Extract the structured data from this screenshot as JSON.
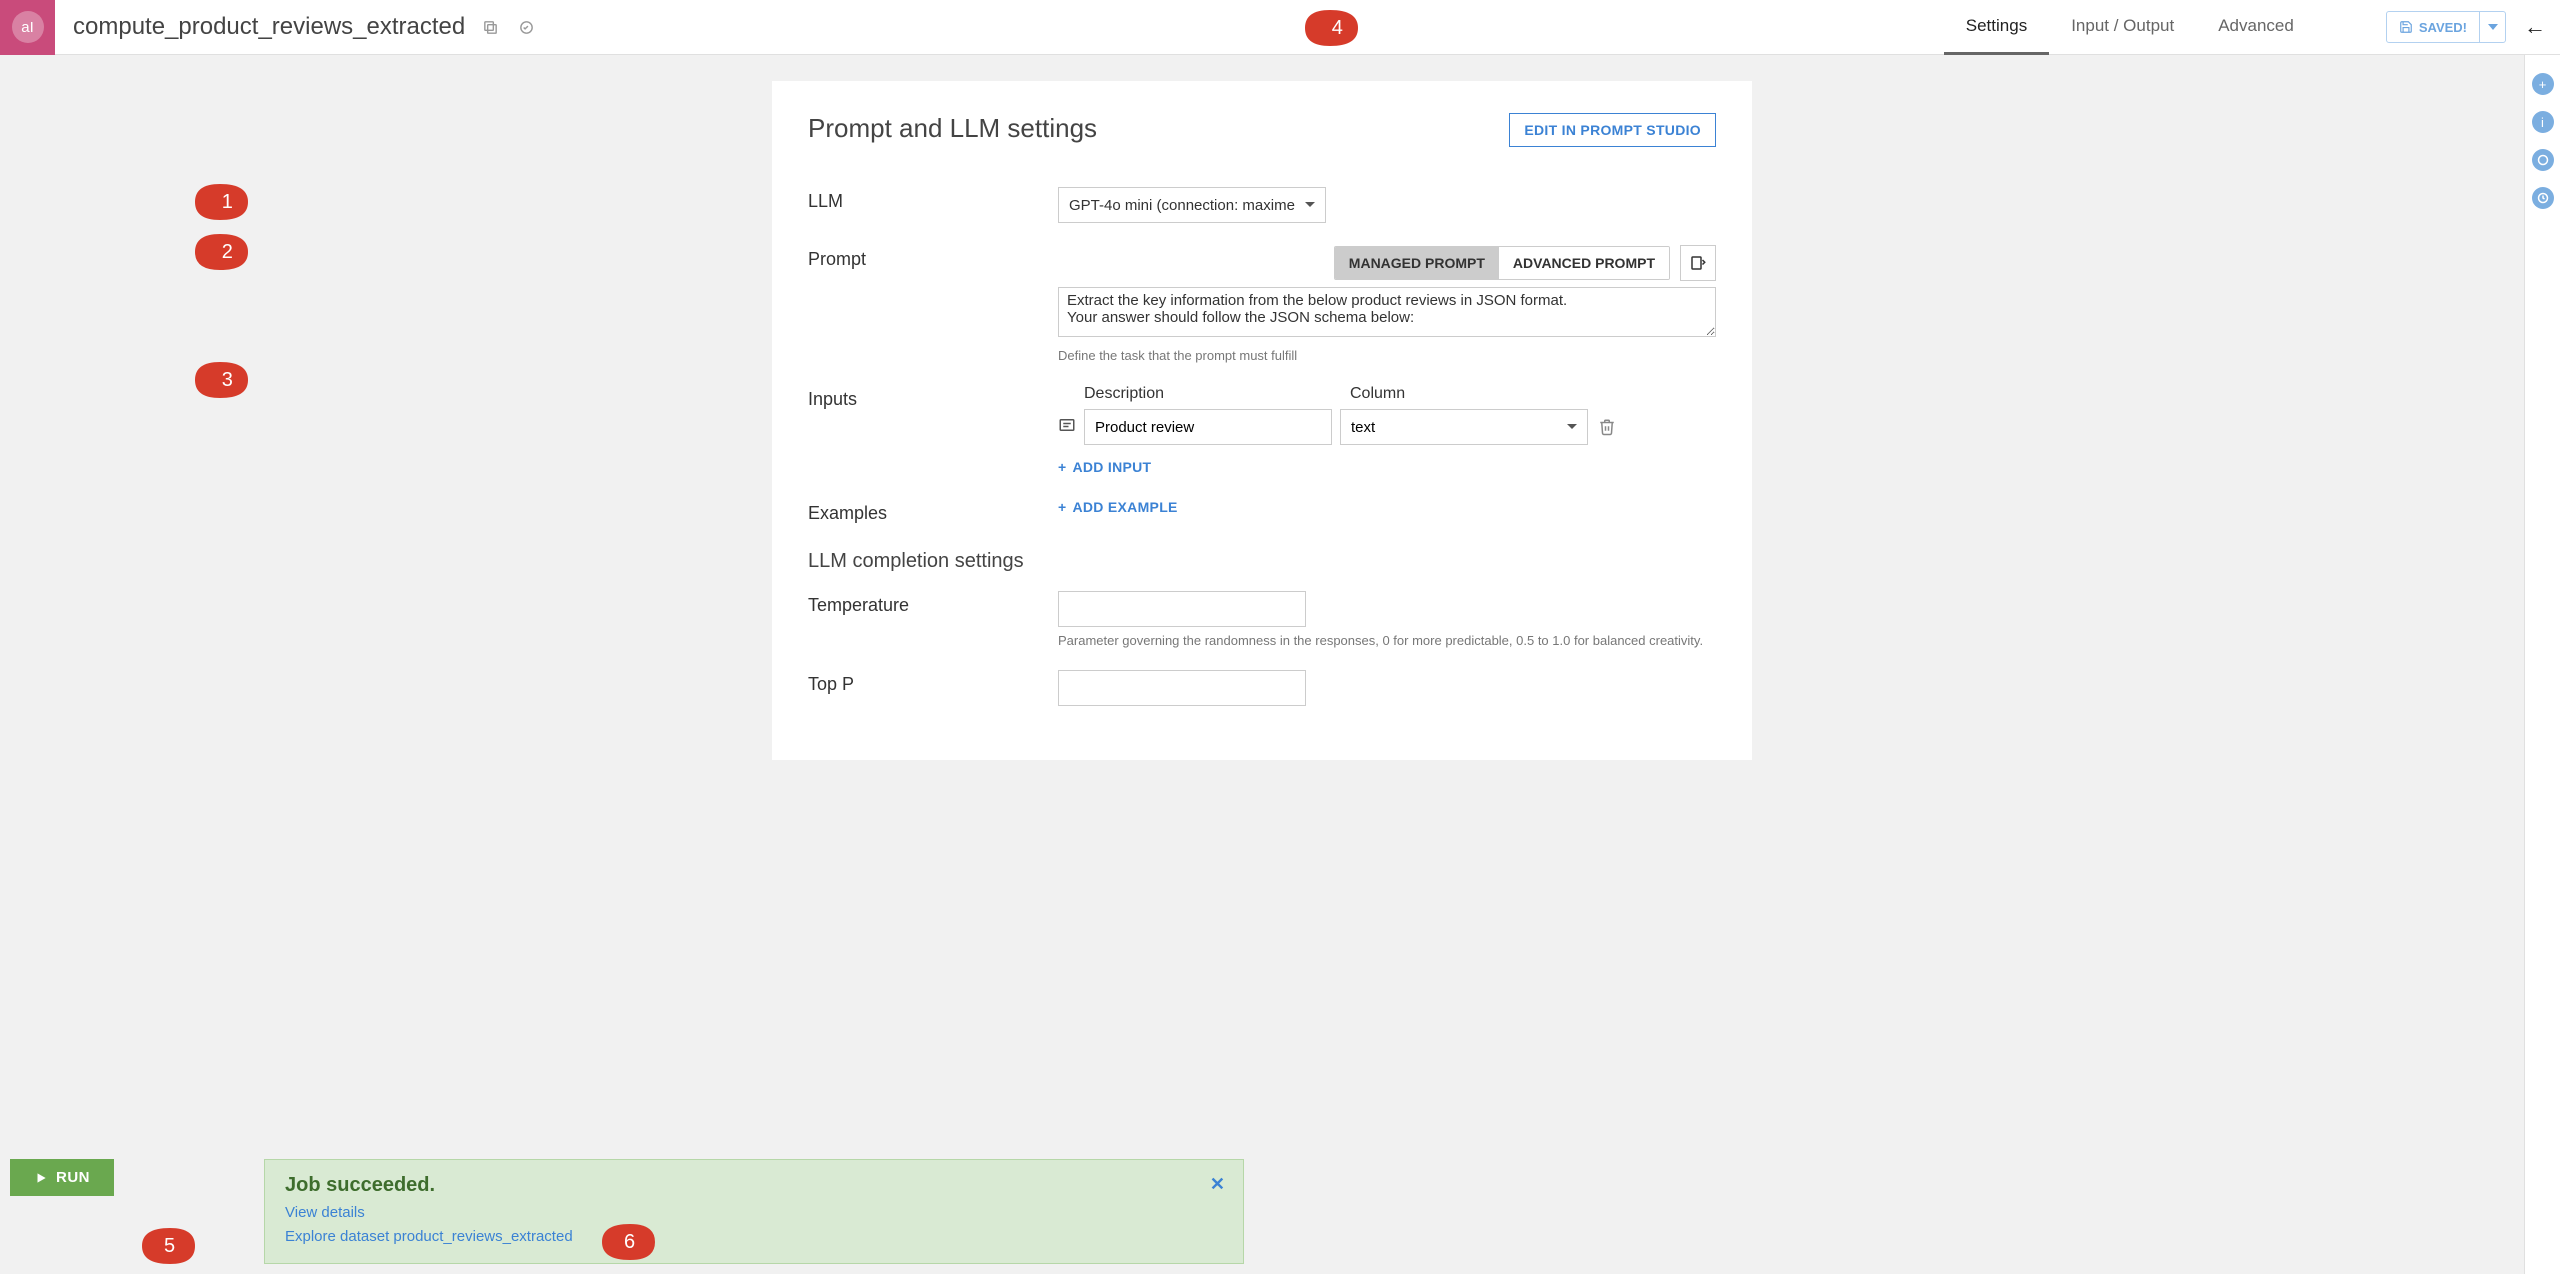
{
  "header": {
    "logo_text": "aI",
    "title": "compute_product_reviews_extracted",
    "tabs": [
      "Settings",
      "Input / Output",
      "Advanced"
    ],
    "active_tab": 0,
    "saved_label": "SAVED!"
  },
  "card": {
    "title": "Prompt and LLM settings",
    "edit_studio": "EDIT IN PROMPT STUDIO"
  },
  "llm": {
    "label": "LLM",
    "value": "GPT-4o mini (connection: maxime"
  },
  "prompt": {
    "label": "Prompt",
    "managed": "MANAGED PROMPT",
    "advanced": "ADVANCED PROMPT",
    "text": "Extract the key information from the below product reviews in JSON format.\nYour answer should follow the JSON schema below:",
    "hint": "Define the task that the prompt must fulfill"
  },
  "inputs": {
    "label": "Inputs",
    "col_description": "Description",
    "col_column": "Column",
    "rows": [
      {
        "description": "Product review",
        "column": "text"
      }
    ],
    "add_label": "ADD INPUT"
  },
  "examples": {
    "label": "Examples",
    "add_label": "ADD EXAMPLE"
  },
  "completion": {
    "title": "LLM completion settings",
    "temperature_label": "Temperature",
    "temperature_value": "",
    "temperature_hint": "Parameter governing the randomness in the responses, 0 for more predictable, 0.5 to 1.0 for balanced creativity.",
    "top_p_label": "Top P"
  },
  "run_button": "RUN",
  "job": {
    "title": "Job succeeded.",
    "view_details": "View details",
    "explore": "Explore dataset product_reviews_extracted"
  },
  "callouts": [
    "1",
    "2",
    "3",
    "4",
    "5",
    "6"
  ]
}
